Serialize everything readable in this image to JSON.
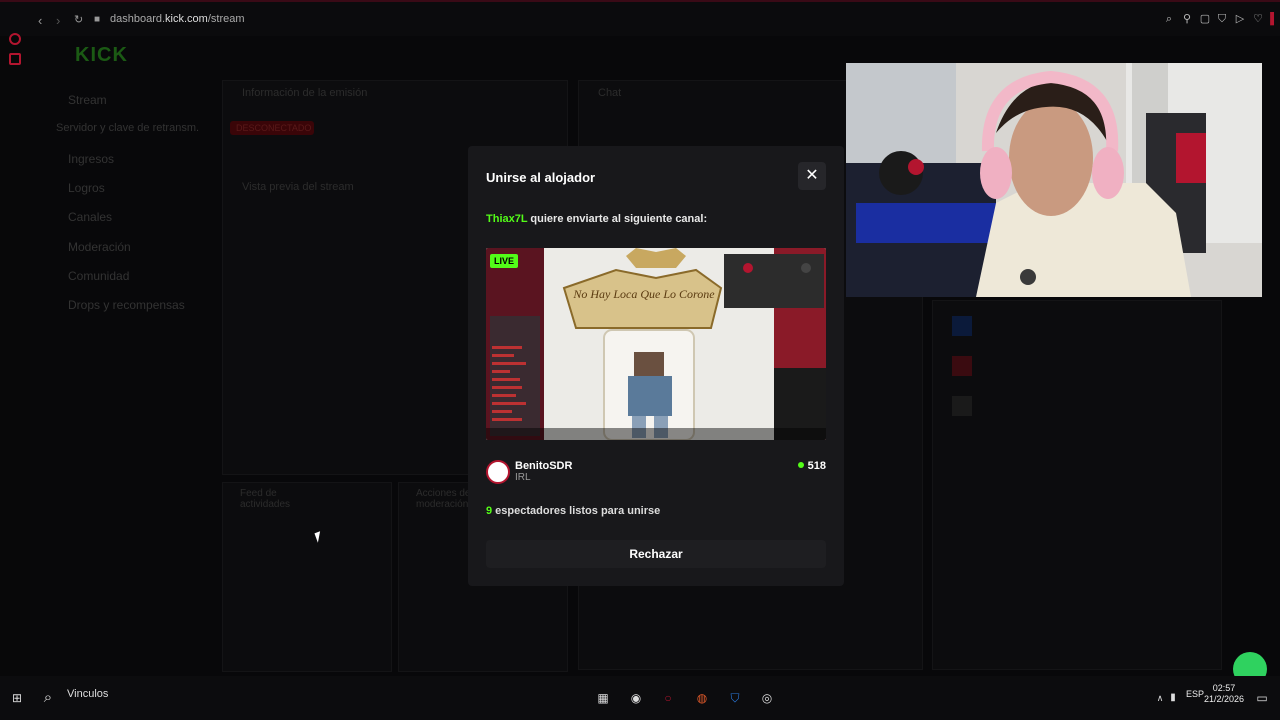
{
  "browser": {
    "url_prefix": "dashboard.",
    "url_domain": "kick.com",
    "url_path": "/stream"
  },
  "dashboard": {
    "logo": "KICK",
    "sidebar": {
      "items": [
        {
          "label": "Stream"
        },
        {
          "label": "Servidor y clave de retransm."
        },
        {
          "label": "Ingresos"
        },
        {
          "label": "Logros"
        },
        {
          "label": "Canales"
        },
        {
          "label": "Moderación"
        },
        {
          "label": "Comunidad"
        },
        {
          "label": "Drops y recompensas"
        }
      ]
    },
    "panels": {
      "stream_info": "Información de la emisión",
      "preview": "Vista previa del stream",
      "chat": "Chat",
      "activity": "Feed de actividades",
      "actions": "Acciones de moderación"
    },
    "status_pill": "DESCONECTADO"
  },
  "modal": {
    "title": "Unirse al alojador",
    "close_icon": "close-icon",
    "invite_user": "Thiax7L",
    "invite_text": " quiere enviarte al siguiente canal:",
    "live_badge": "LIVE",
    "preview_crown_text": "No Hay Loca Que Lo Corone",
    "channel": {
      "name": "BenitoSDR",
      "category": "IRL",
      "viewers": "518"
    },
    "ready_count": "9",
    "ready_text": " espectadores listos para unirse",
    "reject_label": "Rechazar"
  },
  "taskbar": {
    "search_label": "Vinculos",
    "lang": "ESP",
    "time": "02:57",
    "date": "21/2/2026"
  },
  "colors": {
    "accent_green": "#53fc18",
    "modal_bg": "#18181b",
    "brand_red": "#b3152f"
  }
}
